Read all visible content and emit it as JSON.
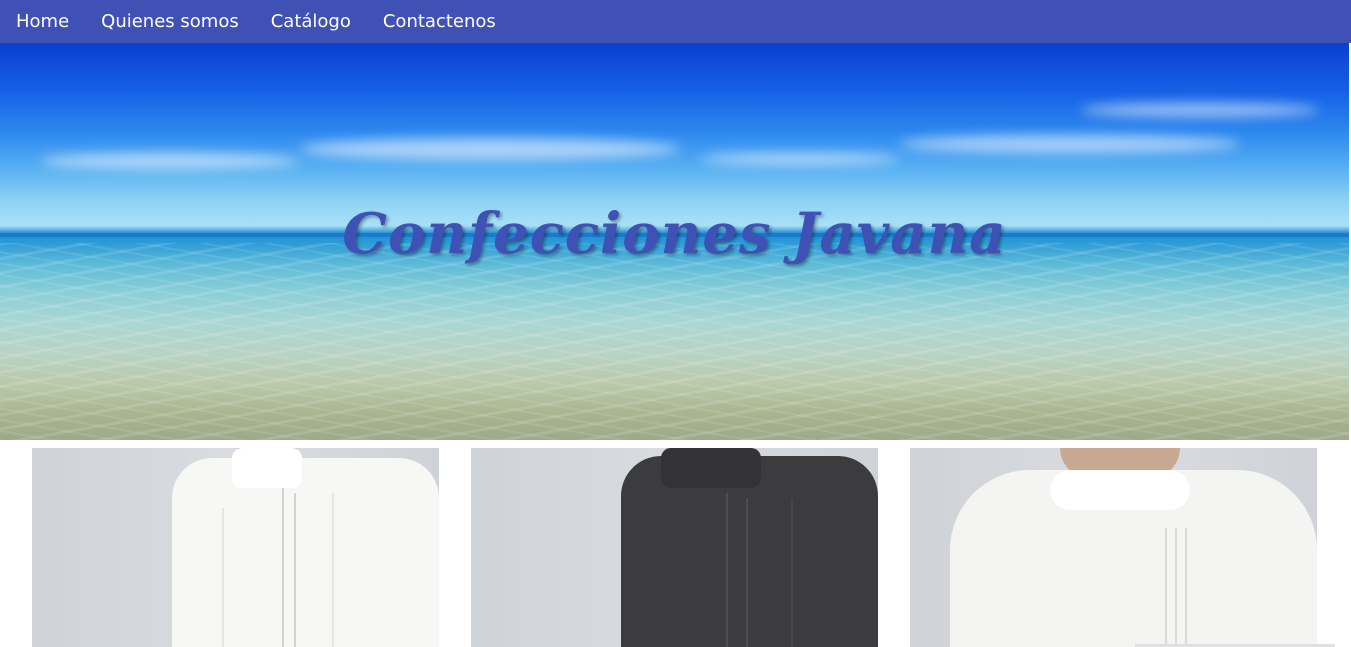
{
  "nav": {
    "items": [
      {
        "label": "Home"
      },
      {
        "label": "Quienes somos"
      },
      {
        "label": "Catálogo"
      },
      {
        "label": "Contactenos"
      }
    ],
    "background": "#3f51b5",
    "text_color": "#ffffff"
  },
  "hero": {
    "title": "Confecciones Javana",
    "title_color": "#3f51b5"
  },
  "gallery": {
    "items": [
      {
        "image": "white-guayabera-front",
        "shirt_color": "#f7f7f5"
      },
      {
        "image": "black-guayabera-front",
        "shirt_color": "#3c3c3e"
      },
      {
        "image": "white-guayabera-back",
        "shirt_color": "#f4f4f2"
      }
    ]
  }
}
